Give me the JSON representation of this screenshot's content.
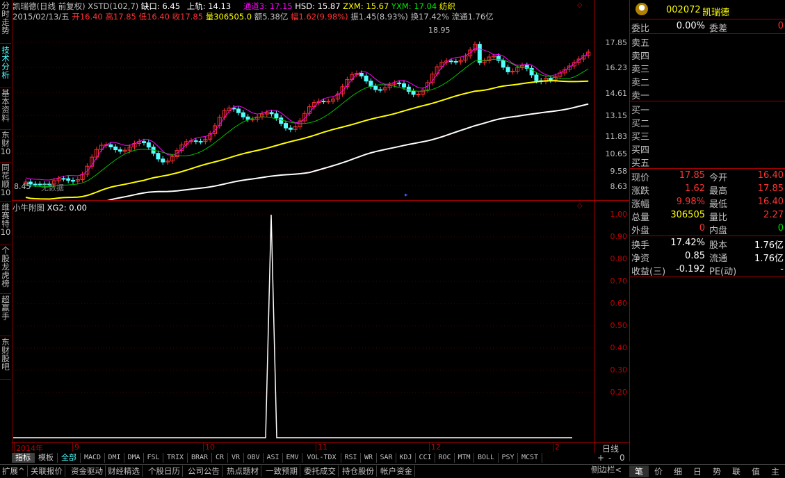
{
  "left_tabs": [
    "分时走势",
    "技术分析",
    "基本资料",
    "东财10",
    "同花顺10",
    "维赛特10",
    "个股龙虎榜",
    "超赢手",
    "东财股吧"
  ],
  "main": {
    "title_prefix": "凯瑞德(日线 前复权)",
    "xstd": "XSTD(102,7)",
    "queko": "缺口: 6.45",
    "shanggui": "上轨: 14.13",
    "tongdao": "通道3: 17.15",
    "hsd": "HSD: 15.87",
    "zxm": "ZXM: 15.67",
    "yxm": "YXM: 17.04",
    "fangzhi": "纺织",
    "date": "2015/02/13/五",
    "kai": "开16.40",
    "gao": "高17.85",
    "di": "低16.40",
    "shou": "收17.85",
    "liang": "量306505.0",
    "e": "额5.38亿",
    "fu": "幅1.62(9.98%)",
    "zhen": "振1.45(8.93%)",
    "huan": "换17.42%",
    "liutong": "流通1.76亿",
    "peak_label": "18.95",
    "low_label": "8.45",
    "low_note": "无数据",
    "axis_labels": [
      "17.85",
      "16.23",
      "14.61",
      "13.15",
      "11.83",
      "10.65",
      "9.58",
      "8.63"
    ]
  },
  "sub": {
    "title": "小牛附图",
    "xg2": "XG2: 0.00",
    "axis_labels": [
      "1.00",
      "0.90",
      "0.80",
      "0.70",
      "0.60",
      "0.50",
      "0.40",
      "0.30",
      "0.20"
    ]
  },
  "dates": [
    "2014年",
    "9",
    "10",
    "11",
    "12",
    "2"
  ],
  "period": "日线",
  "indicators": [
    "指标",
    "模板",
    "全部",
    "MACD",
    "DMI",
    "DMA",
    "FSL",
    "TRIX",
    "BRAR",
    "CR",
    "VR",
    "OBV",
    "ASI",
    "EMV",
    "VOL-TDX",
    "RSI",
    "WR",
    "SAR",
    "KDJ",
    "CCI",
    "ROC",
    "MTM",
    "BOLL",
    "PSY",
    "MCST"
  ],
  "nav_buttons": [
    "+",
    "-",
    "0"
  ],
  "functions": [
    "扩展^",
    "关联报价",
    "资金驱动",
    "财经精选",
    "个股日历",
    "公司公告",
    "热点题材",
    "一致预期",
    "委托成交",
    "持仓股份",
    "帐户资金"
  ],
  "right_panel": {
    "code": "002072",
    "name": "凯瑞德",
    "weibi_label": "委比",
    "weibi": "0.00%",
    "weicha_label": "委差",
    "weicha": "0",
    "sell": [
      "卖五",
      "卖四",
      "卖三",
      "卖二",
      "卖一"
    ],
    "buy": [
      "买一",
      "买二",
      "买三",
      "买四",
      "买五"
    ],
    "quote": [
      {
        "l1": "现价",
        "v1": "17.85",
        "l2": "今开",
        "v2": "16.40"
      },
      {
        "l1": "涨跌",
        "v1": "1.62",
        "l2": "最高",
        "v2": "17.85"
      },
      {
        "l1": "涨幅",
        "v1": "9.98%",
        "l2": "最低",
        "v2": "16.40"
      },
      {
        "l1": "总量",
        "v1": "306505",
        "l2": "量比",
        "v2": "2.27"
      },
      {
        "l1": "外盘",
        "v1": "0",
        "l2": "内盘",
        "v2": "0"
      }
    ],
    "fund": [
      {
        "l1": "换手",
        "v1": "17.42%",
        "l2": "股本",
        "v2": "1.76亿"
      },
      {
        "l1": "净资",
        "v1": "0.85",
        "l2": "流通",
        "v2": "1.76亿"
      },
      {
        "l1": "收益(三)",
        "v1": "-0.192",
        "l2": "PE(动)",
        "v2": "-"
      }
    ]
  },
  "side_bar": "侧边栏<",
  "right_tabs": [
    "笔",
    "价",
    "细",
    "日",
    "势",
    "联",
    "值",
    "主"
  ],
  "colors": {
    "up": "#ff3232",
    "down": "#54ffff",
    "ma_yellow": "#ffff00",
    "ma_white": "#ffffff",
    "ma_magenta": "#ff00ff",
    "ma_green": "#00c000",
    "border": "#a00000"
  }
}
